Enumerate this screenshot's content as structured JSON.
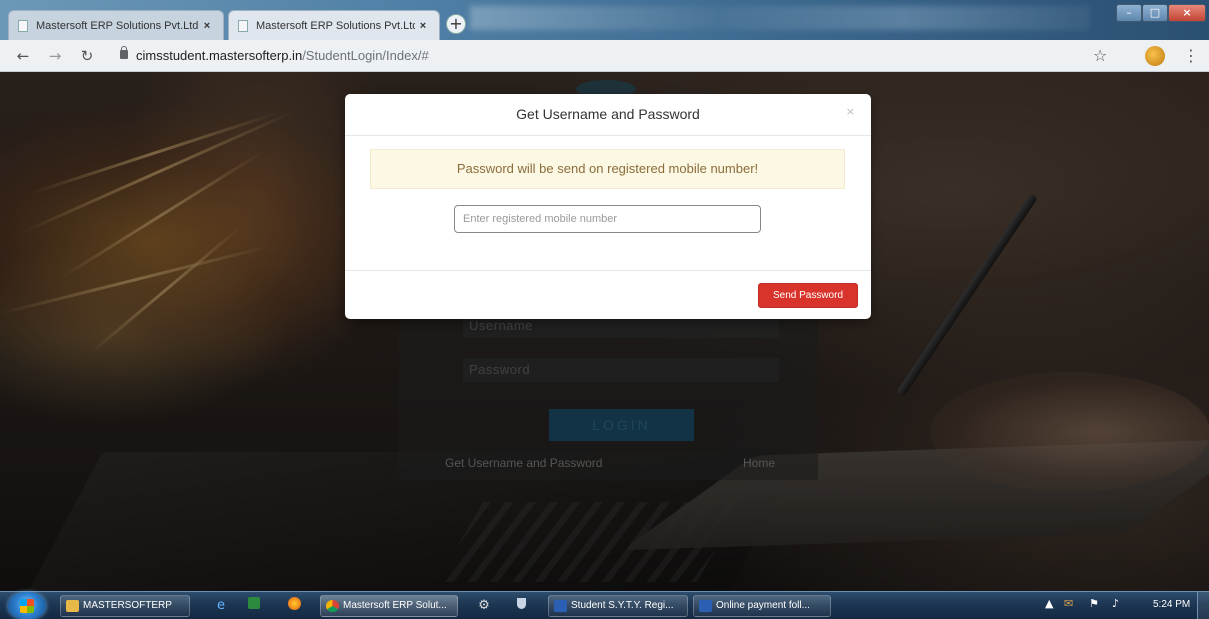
{
  "browser": {
    "tabs": [
      {
        "title": "Mastersoft ERP Solutions Pvt.Ltd",
        "close": "×",
        "active": false
      },
      {
        "title": "Mastersoft ERP Solutions Pvt.Ltd",
        "close": "×",
        "active": true
      }
    ],
    "new_tab": "+",
    "url_host": "cimsstudent.mastersofterp.in",
    "url_path": "/StudentLogin/Index/#",
    "window_controls": {
      "minimize": "–",
      "maximize": "□",
      "close": "×"
    }
  },
  "login": {
    "username_placeholder": "Username",
    "password_placeholder": "Password",
    "login_button": "LOGIN",
    "get_credentials_link": "Get Username and Password",
    "home_link": "Home"
  },
  "modal": {
    "title": "Get Username and Password",
    "close_symbol": "×",
    "alert_text": "Password will be send on registered mobile number!",
    "mobile_placeholder": "Enter registered mobile number",
    "mobile_value": "",
    "send_button": "Send Password",
    "colors": {
      "send_button": "#d9342b",
      "alert_bg": "#fcf8e3",
      "alert_text": "#8a6d3b"
    }
  },
  "taskbar": {
    "items": [
      {
        "label": "MASTERSOFTERP",
        "icon": "folder-icon"
      },
      {
        "label": "Mastersoft ERP Solut...",
        "icon": "chrome-icon"
      },
      {
        "label": "Student S.Y.T.Y. Regi...",
        "icon": "word-icon"
      },
      {
        "label": "Online payment foll...",
        "icon": "word-icon"
      }
    ],
    "clock": "5:24 PM"
  }
}
